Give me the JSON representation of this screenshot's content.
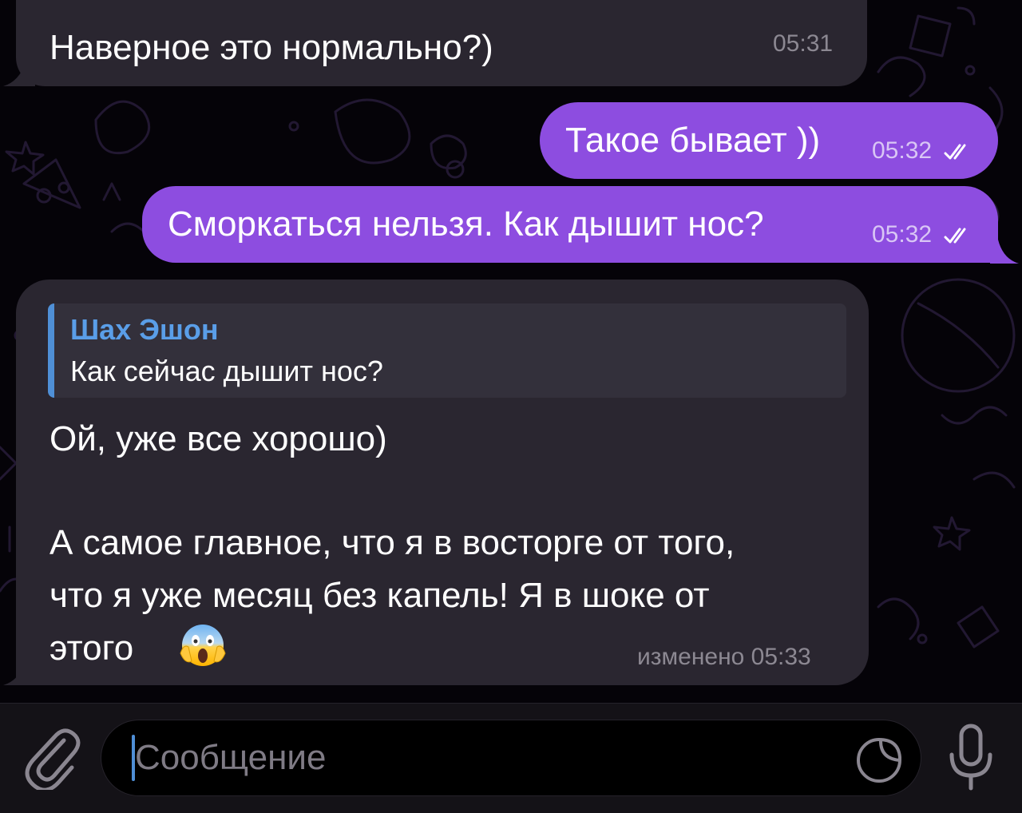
{
  "messages": [
    {
      "id": "m1",
      "direction": "incoming",
      "text": "Наверное это нормально?)",
      "time": "05:31"
    },
    {
      "id": "m2",
      "direction": "outgoing",
      "text": "Такое бывает ))",
      "time": "05:32",
      "status": "read"
    },
    {
      "id": "m3",
      "direction": "outgoing",
      "text": "Сморкаться нельзя. Как дышит нос?",
      "time": "05:32",
      "status": "read"
    },
    {
      "id": "m4",
      "direction": "incoming",
      "reply": {
        "author": "Шах Эшон",
        "text": "Как сейчас дышит нос?"
      },
      "lines": [
        "Ой, уже все хорошо)",
        "А самое главное, что я в восторге от того,",
        "что я уже месяц без капель! Я в шоке от",
        "этого"
      ],
      "emoji": "😱",
      "time": "изменено 05:33"
    }
  ],
  "composer": {
    "placeholder": "Сообщение",
    "icons": [
      "paperclip-icon",
      "sticker-icon",
      "microphone-icon"
    ]
  },
  "colors": {
    "outgoing_bubble": "#8d4de0",
    "incoming_bubble": "#2a2630",
    "reply_accent": "#4f8fd6",
    "background": "#050308"
  }
}
